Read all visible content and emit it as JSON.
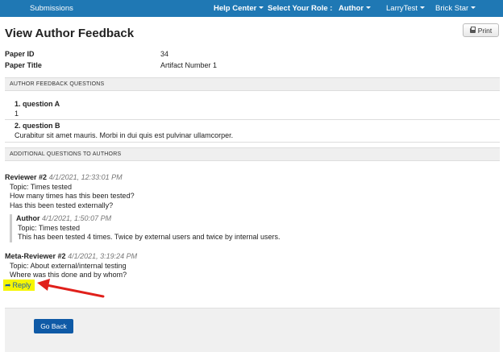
{
  "nav": {
    "submissions": "Submissions",
    "help_center": "Help Center",
    "select_role": "Select Your Role :",
    "role": "Author",
    "user": "LarryTest",
    "org": "Brick Star"
  },
  "page": {
    "title": "View Author Feedback",
    "print_label": "Print"
  },
  "meta": {
    "paper_id_label": "Paper ID",
    "paper_id_value": "34",
    "paper_title_label": "Paper Title",
    "paper_title_value": "Artifact Number 1"
  },
  "author_feedback": {
    "heading": "AUTHOR FEEDBACK QUESTIONS",
    "questions": [
      {
        "q": "1. question A",
        "a": "1"
      },
      {
        "q": "2. question B",
        "a": "Curabitur sit amet mauris. Morbi in dui quis est pulvinar ullamcorper."
      }
    ]
  },
  "additional": {
    "heading": "ADDITIONAL QUESTIONS TO AUTHORS",
    "reviewer": {
      "who": "Reviewer #2",
      "date": "4/1/2021, 12:33:01 PM",
      "topic": "Topic: Times tested",
      "lines": [
        "How many times has this been tested?",
        "Has this been tested externally?"
      ]
    },
    "author_reply": {
      "who": "Author",
      "date": "4/1/2021, 1:50:07 PM",
      "topic": "Topic: Times tested",
      "text": "This has been tested 4 times. Twice by external users and twice by internal users."
    },
    "meta_reviewer": {
      "who": "Meta-Reviewer #2",
      "date": "4/1/2021, 3:19:24 PM",
      "topic": "Topic: About external/internal testing",
      "text": "Where was this done and by whom?"
    },
    "reply_label": "Reply"
  },
  "footer": {
    "go_back": "Go Back"
  },
  "colors": {
    "nav_bg": "#1f78b4",
    "button_bg": "#0f5aa6",
    "highlight": "#f6f600",
    "annotation": "#e0201b"
  }
}
